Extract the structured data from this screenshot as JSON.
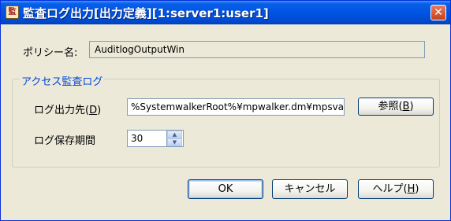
{
  "window": {
    "title": "監査ログ出力[出力定義][1:server1:user1]",
    "app_icon_glyph": "監",
    "close_glyph": "✕"
  },
  "policy": {
    "label": "ポリシー名:",
    "value": "AuditlogOutputWin"
  },
  "group": {
    "title": "アクセス監査ログ",
    "output_label": "ログ出力先(",
    "output_mnemonic": "D",
    "output_suffix": ")",
    "output_value": "%SystemwalkerRoot%¥mpwalker.dm¥mpsvad",
    "browse_label": "参照(",
    "browse_mnemonic": "B",
    "browse_suffix": ")",
    "retention_label": "ログ保存期間",
    "retention_value": "30",
    "spin_up": "▲",
    "spin_down": "▼"
  },
  "buttons": {
    "ok": "OK",
    "cancel": "キャンセル",
    "help_label": "ヘルプ(",
    "help_mnemonic": "H",
    "help_suffix": ")"
  },
  "colors": {
    "titlebar": "#0054e3",
    "group_title": "#0046d5",
    "dialog_bg": "#ece9d8"
  }
}
